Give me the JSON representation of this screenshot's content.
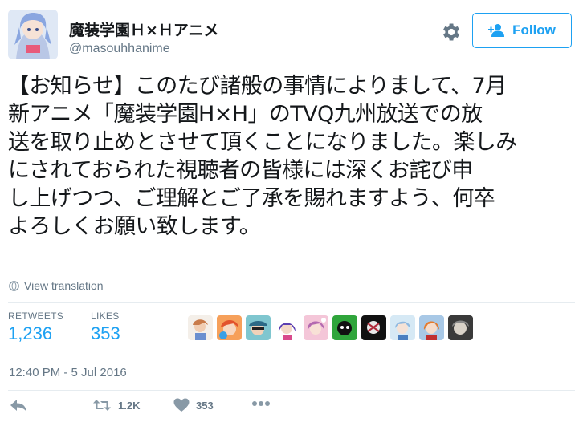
{
  "author": {
    "display_name": "魔装学園Ｈ×Ｈアニメ",
    "handle": "@masouhhanime",
    "follow_label": "Follow"
  },
  "tweet": {
    "lines": [
      "【お知らせ】このたび諸般の事情によりまして、7月",
      "新アニメ「魔装学園H×H」のTVQ九州放送での放",
      "送を取り止めとさせて頂くことになりました。楽しみ",
      "にされておられた視聴者の皆様には深くお詫び申",
      "し上げつつ、ご理解とご了承を賜れますよう、何卒",
      "よろしくお願い致します。"
    ],
    "translate_label": "View translation"
  },
  "stats": {
    "retweets_label": "RETWEETS",
    "retweets": "1,236",
    "likes_label": "LIKES",
    "likes": "353"
  },
  "timestamp": "12:40 PM - 5 Jul 2016",
  "actions": {
    "retweet_count": "1.2K",
    "like_count": "353"
  },
  "colors": {
    "accent": "#1da1f2",
    "muted": "#657786",
    "divider": "#e6ecf0"
  },
  "icons": [
    "gear-icon",
    "add-user-icon",
    "globe-icon",
    "reply-icon",
    "retweet-icon",
    "heart-icon",
    "more-icon"
  ]
}
